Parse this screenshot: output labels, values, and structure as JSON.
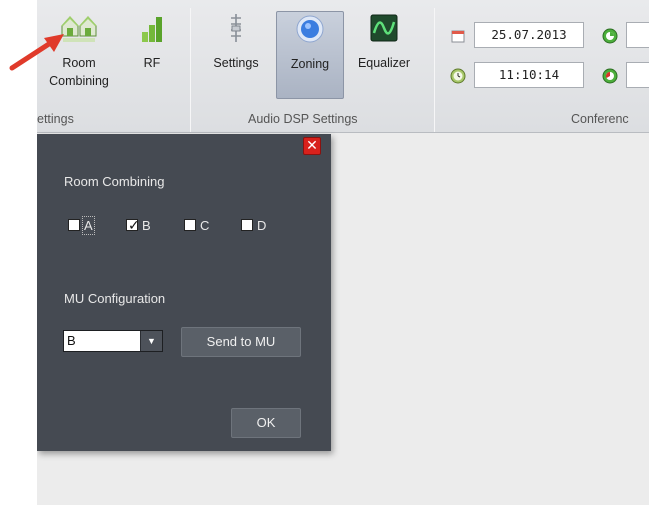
{
  "ribbon": {
    "buttons": [
      {
        "label": "Room\nCombining",
        "icon": "room-combining-icon"
      },
      {
        "label": "RF",
        "icon": "rf-signal-icon"
      },
      {
        "label": "Settings",
        "icon": "settings-slider-icon"
      },
      {
        "label": "Zoning",
        "icon": "zoning-icon"
      },
      {
        "label": "Equalizer",
        "icon": "equalizer-icon"
      }
    ],
    "groups": {
      "settings": "ettings",
      "audio_dsp": "Audio DSP Settings",
      "conference": "Conferenc"
    },
    "date": "25.07.2013",
    "time": "11:10:14"
  },
  "dialog": {
    "section_room": "Room Combining",
    "checkboxes": [
      {
        "label": "A",
        "checked": false
      },
      {
        "label": "B",
        "checked": true
      },
      {
        "label": "C",
        "checked": false
      },
      {
        "label": "D",
        "checked": false
      }
    ],
    "section_mu": "MU Configuration",
    "mu_select_value": "B",
    "send_button": "Send to MU",
    "ok_button": "OK",
    "close_icon": "close-icon"
  },
  "colors": {
    "dialog_bg": "#454a52",
    "close_red": "#d8211c",
    "pointer_arrow": "#e03a2a"
  }
}
